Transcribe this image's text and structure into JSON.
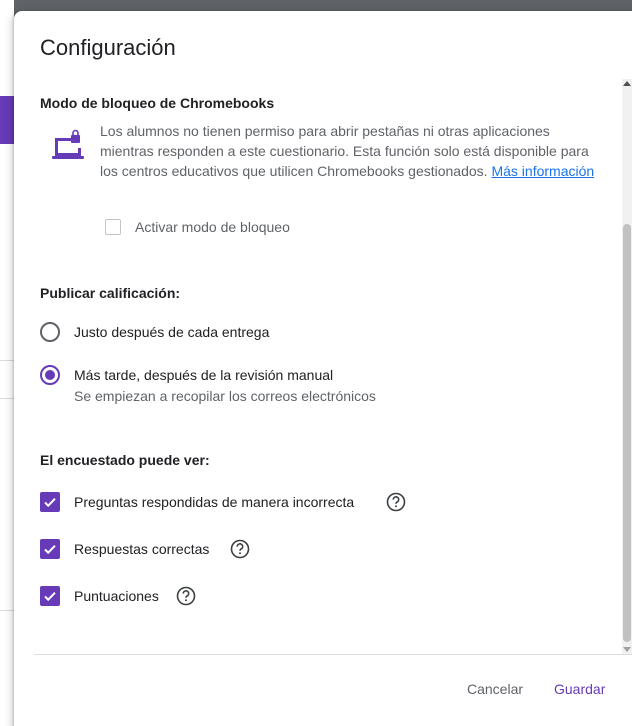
{
  "dialog": {
    "title": "Configuración"
  },
  "lock_mode": {
    "heading": "Modo de bloqueo de Chromebooks",
    "description": "Los alumnos no tienen permiso para abrir pestañas ni otras aplicaciones mientras responden a este cuestionario. Esta función solo está disponible para los centros educativos que utilicen Chromebooks gestionados.",
    "link_label": "Más información",
    "checkbox_label": "Activar modo de bloqueo",
    "checkbox_checked": false,
    "icon": "laptop-lock-icon"
  },
  "grade_release": {
    "heading": "Publicar calificación:",
    "options": [
      {
        "label": "Justo después de cada entrega",
        "selected": false
      },
      {
        "label": "Más tarde, después de la revisión manual",
        "sublabel": "Se empiezan a recopilar los correos electrónicos",
        "selected": true
      }
    ]
  },
  "respondent_can_see": {
    "heading": "El encuestado puede ver:",
    "items": [
      {
        "label": "Preguntas respondidas de manera incorrecta",
        "checked": true
      },
      {
        "label": "Respuestas correctas",
        "checked": true
      },
      {
        "label": "Puntuaciones",
        "checked": true
      }
    ]
  },
  "footer": {
    "cancel_label": "Cancelar",
    "save_label": "Guardar"
  },
  "colors": {
    "accent": "#673ab7",
    "link": "#1a73e8",
    "text_primary": "#202124",
    "text_secondary": "#5f6368"
  }
}
